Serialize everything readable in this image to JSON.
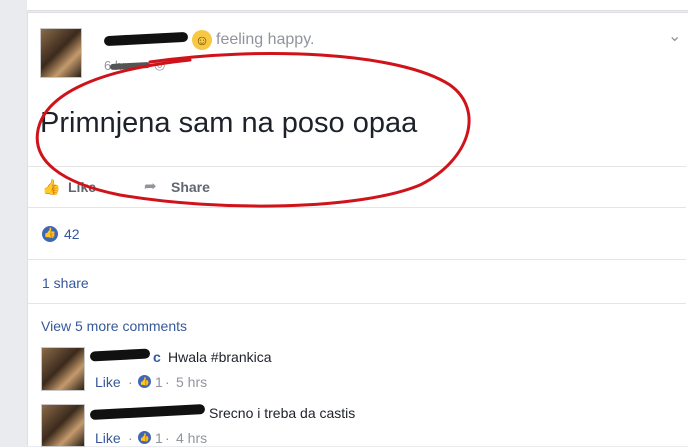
{
  "post": {
    "feeling": "feeling happy.",
    "time": "6 hrs",
    "text": "Primnjena sam na poso opaa",
    "like_label": "Like",
    "share_label": "Share",
    "like_count": "42",
    "shares": "1 share"
  },
  "comments": {
    "view_more": "View 5 more comments",
    "items": [
      {
        "author": "c",
        "text": "Hwala #brankica",
        "like_label": "Like",
        "sep": "·",
        "likes": "1",
        "time": "5 hrs"
      },
      {
        "author": "",
        "text": "Srecno i treba da castis",
        "like_label": "Like",
        "sep": "·",
        "likes": "1",
        "time": "4 hrs"
      }
    ]
  },
  "colors": {
    "annotation": "#d0131a",
    "facebook_blue": "#4267b2",
    "link_blue": "#365899"
  }
}
